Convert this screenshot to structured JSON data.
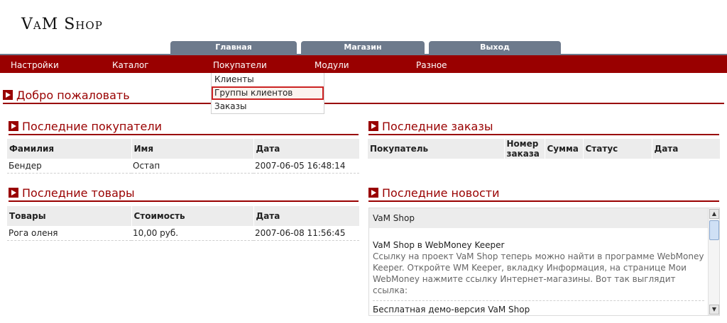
{
  "logo": "VaM Shop",
  "tabs": [
    "Главная",
    "Магазин",
    "Выход"
  ],
  "nav": {
    "settings": "Настройки",
    "catalog": "Каталог",
    "customers": "Покупатели",
    "modules": "Модули",
    "misc": "Разное"
  },
  "dropdown": {
    "items": [
      "Клиенты",
      "Группы клиентов",
      "Заказы"
    ],
    "selected": "Группы клиентов"
  },
  "welcome": "Добро пожаловать",
  "latest_customers": {
    "title": "Последние покупатели",
    "headers": [
      "Фамилия",
      "Имя",
      "Дата"
    ],
    "rows": [
      [
        "Бендер",
        "Остап",
        "2007-06-05 16:48:14"
      ]
    ]
  },
  "latest_orders": {
    "title": "Последние заказы",
    "headers": [
      "Покупатель",
      "Номер заказа",
      "Сумма",
      "Статус",
      "Дата"
    ]
  },
  "latest_products": {
    "title": "Последние товары",
    "headers": [
      "Товары",
      "Стоимость",
      "Дата"
    ],
    "rows": [
      [
        "Рога оленя",
        "10,00 руб.",
        "2007-06-08 11:56:45"
      ]
    ]
  },
  "latest_news": {
    "title": "Последние новости",
    "source": "VaM Shop",
    "items": [
      {
        "title": "VaM Shop в WebMoney Keeper",
        "text": "Ссылку на проект VaM Shop теперь можно найти в программе WebMoney Keeper. Откройте WM Keeper, вкладку Информация, на странице Мои WebMoney нажмите ссылку Интернет-магазины. Вот так выглядит ссылка:"
      },
      {
        "title": "Бесплатная демо-версия VaM Shop"
      }
    ]
  },
  "colors": {
    "accent": "#990000",
    "tab": "#6d7a8c",
    "header_bg": "#ececec"
  }
}
